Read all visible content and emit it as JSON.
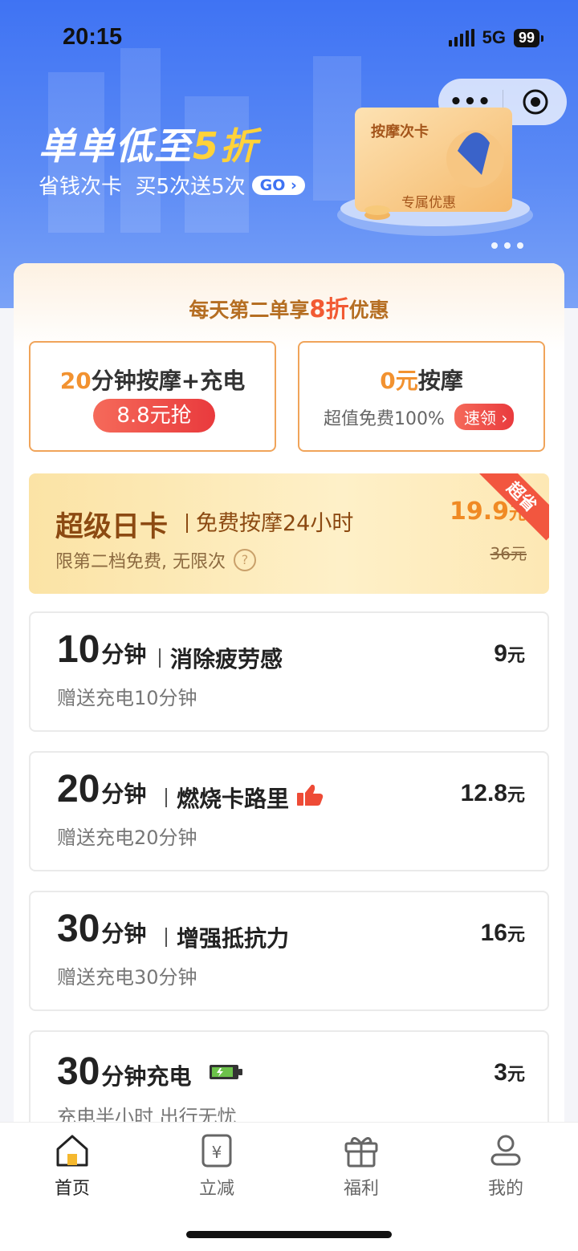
{
  "status": {
    "time": "20:15",
    "network": "5G",
    "battery": "99"
  },
  "miniapp": {
    "more_label": "•••"
  },
  "banner": {
    "title_prefix": "单单低至",
    "title_highlight": "5折",
    "subtitle": "省钱次卡  买5次送5次",
    "go_label": "GO",
    "card_title": "按摩次卡",
    "card_badge": "专属优惠"
  },
  "promo": {
    "prefix": "每天第二单享",
    "highlight": "8折",
    "suffix": "优惠"
  },
  "offers": [
    {
      "highlight": "20",
      "title": "分钟按摩+充电",
      "button": "8.8元抢"
    },
    {
      "highlight": "0元",
      "title": "按摩",
      "sub": "超值免费100%",
      "button": "速领"
    }
  ],
  "day_card": {
    "name": "超级日卡",
    "desc": "免费按摩24小时",
    "sub": "限第二档免费, 无限次",
    "help": "?",
    "price": "19.9",
    "price_unit": "元",
    "old_price": "36元",
    "ribbon": "超省"
  },
  "plans": [
    {
      "num": "10",
      "unit": "分钟",
      "tag": "消除疲劳感",
      "sub": "赠送充电10分钟",
      "price": "9",
      "price_unit": "元"
    },
    {
      "num": "20",
      "unit": "分钟",
      "tag": "燃烧卡路里",
      "sub": "赠送充电20分钟",
      "price": "12.8",
      "price_unit": "元"
    },
    {
      "num": "30",
      "unit": "分钟",
      "tag": "增强抵抗力",
      "sub": "赠送充电30分钟",
      "price": "16",
      "price_unit": "元"
    },
    {
      "num": "30",
      "unit": "分钟充电",
      "tag": "",
      "sub": "充电半小时 出行无忧",
      "price": "3",
      "price_unit": "元"
    }
  ],
  "tabs": [
    {
      "label": "首页",
      "icon": "home-icon"
    },
    {
      "label": "立减",
      "icon": "coupon-icon"
    },
    {
      "label": "福利",
      "icon": "gift-icon"
    },
    {
      "label": "我的",
      "icon": "user-icon"
    }
  ]
}
